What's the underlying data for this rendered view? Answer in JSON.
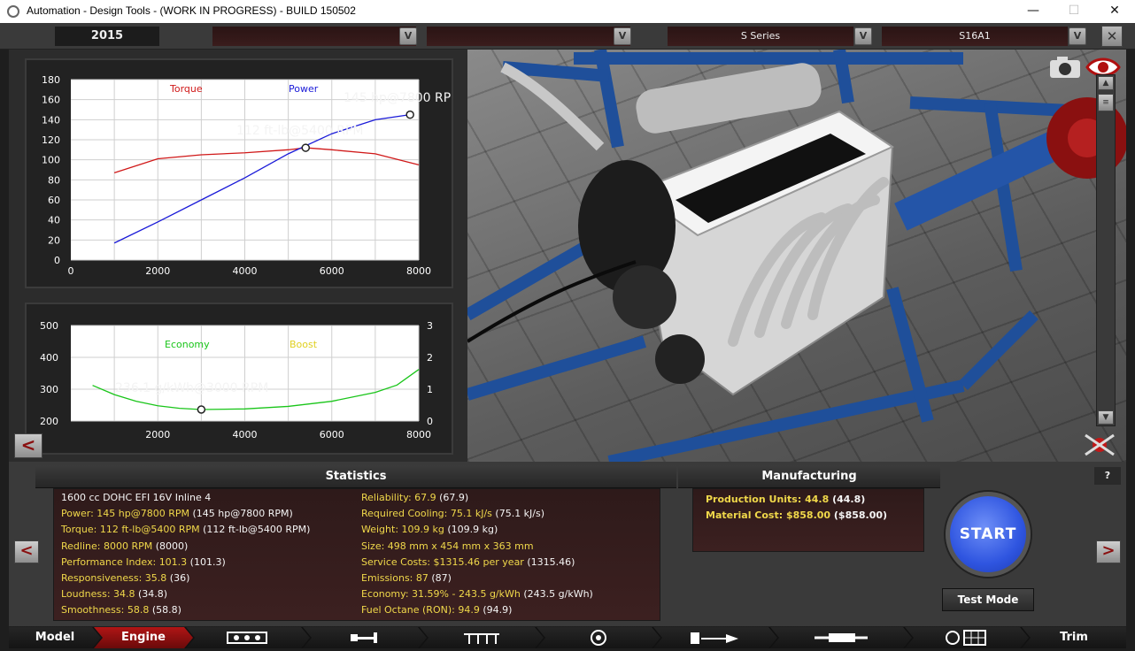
{
  "window": {
    "title": "Automation - Design Tools - (WORK IN PROGRESS) - BUILD 150502",
    "minimize_glyph": "—",
    "maximize_glyph": "☐",
    "close_glyph": "✕"
  },
  "selectors": {
    "year": "2015",
    "slot1": "",
    "slot2": "",
    "series": "S Series",
    "variant": "S16A1",
    "dropdown_glyph": "V",
    "close_glyph": "✕"
  },
  "power_chart": {
    "legend_torque": "Torque",
    "legend_power": "Power",
    "y_ticks": [
      "180",
      "160",
      "140",
      "120",
      "100",
      "80",
      "60",
      "40",
      "20",
      "0"
    ],
    "x_ticks": [
      "0",
      "2000",
      "4000",
      "6000",
      "8000"
    ],
    "power_peak_label": "145 hp@7800 RPM",
    "torque_peak_label": "112 ft-lb@5400 RPM"
  },
  "economy_chart": {
    "legend_economy": "Economy",
    "legend_boost": "Boost",
    "y_left_ticks": [
      "500",
      "400",
      "300",
      "200"
    ],
    "y_right_ticks": [
      "3",
      "2",
      "1",
      "0"
    ],
    "x_ticks": [
      "2000",
      "4000",
      "6000",
      "8000"
    ],
    "economy_min_label": "236.1 g/kWh@3000 RPM"
  },
  "chart_data": [
    {
      "type": "line",
      "title": "",
      "xlabel": "",
      "ylabel": "",
      "xlim": [
        0,
        8000
      ],
      "ylim": [
        0,
        180
      ],
      "grid": true,
      "series": [
        {
          "name": "Torque",
          "color": "#d01818",
          "x": [
            1000,
            2000,
            3000,
            4000,
            5000,
            5400,
            6000,
            7000,
            8000
          ],
          "y": [
            87,
            101,
            105,
            107,
            110,
            112,
            110,
            106,
            95
          ]
        },
        {
          "name": "Power",
          "color": "#1a1ad8",
          "x": [
            1000,
            2000,
            3000,
            4000,
            5000,
            6000,
            7000,
            7800
          ],
          "y": [
            17,
            38,
            60,
            82,
            106,
            126,
            140,
            145
          ]
        }
      ],
      "annotations": [
        "145 hp@7800 RPM",
        "112 ft-lb@5400 RPM"
      ]
    },
    {
      "type": "line",
      "title": "",
      "xlabel": "",
      "ylabel": "",
      "xlim": [
        0,
        8000
      ],
      "ylim": [
        200,
        500
      ],
      "y2lim": [
        0,
        3
      ],
      "grid": true,
      "series": [
        {
          "name": "Economy",
          "color": "#19c519",
          "x": [
            500,
            1000,
            1500,
            2000,
            2500,
            3000,
            4000,
            5000,
            6000,
            7000,
            7500,
            8000
          ],
          "y": [
            312,
            283,
            262,
            248,
            240,
            236.1,
            238,
            246,
            262,
            290,
            313,
            362
          ]
        }
      ],
      "annotations": [
        "236.1 g/kWh@3000 RPM"
      ]
    }
  ],
  "statistics": {
    "header": "Statistics",
    "left": [
      {
        "k": "1600 cc DOHC EFI 16V Inline 4",
        "v": ""
      },
      {
        "k": "Power: 145 hp@7800 RPM",
        "v": " (145 hp@7800 RPM)"
      },
      {
        "k": "Torque: 112 ft-lb@5400 RPM",
        "v": " (112 ft-lb@5400 RPM)"
      },
      {
        "k": "Redline: 8000 RPM",
        "v": " (8000)"
      },
      {
        "k": "Performance Index: 101.3",
        "v": " (101.3)"
      },
      {
        "k": "Responsiveness: 35.8",
        "v": " (36)"
      },
      {
        "k": "Loudness: 34.8",
        "v": " (34.8)"
      },
      {
        "k": "Smoothness: 58.8",
        "v": " (58.8)"
      }
    ],
    "right": [
      {
        "k": "Reliability: 67.9",
        "v": " (67.9)"
      },
      {
        "k": "Required Cooling: 75.1 kJ/s",
        "v": " (75.1 kJ/s)"
      },
      {
        "k": "Weight: 109.9 kg",
        "v": " (109.9 kg)"
      },
      {
        "k": "Size: 498 mm x 454 mm x 363 mm",
        "v": ""
      },
      {
        "k": "Service Costs: $1315.46 per year",
        "v": " (1315.46)"
      },
      {
        "k": "Emissions: 87",
        "v": " (87)"
      },
      {
        "k": "Economy: 31.59% - 243.5 g/kWh",
        "v": " (243.5 g/kWh)"
      },
      {
        "k": "Fuel Octane (RON): 94.9",
        "v": " (94.9)"
      }
    ]
  },
  "manufacturing": {
    "header": "Manufacturing",
    "production_units": "Production Units: 44.8",
    "production_units_prev": " (44.8)",
    "material_cost": "Material Cost: $858.00",
    "material_cost_prev": " ($858.00)"
  },
  "controls": {
    "start": "START",
    "test_mode": "Test Mode",
    "help": "?",
    "prev": "<",
    "next": ">",
    "back": "<"
  },
  "tabs": [
    {
      "label": "Model",
      "icon": ""
    },
    {
      "label": "Engine",
      "icon": ""
    },
    {
      "label": "",
      "icon": "engine-block-icon"
    },
    {
      "label": "",
      "icon": "crankshaft-icon"
    },
    {
      "label": "",
      "icon": "valvetrain-icon"
    },
    {
      "label": "",
      "icon": "turbo-icon"
    },
    {
      "label": "",
      "icon": "fuel-system-icon"
    },
    {
      "label": "",
      "icon": "exhaust-icon"
    },
    {
      "label": "",
      "icon": "ecu-icon"
    },
    {
      "label": "Trim",
      "icon": ""
    }
  ]
}
